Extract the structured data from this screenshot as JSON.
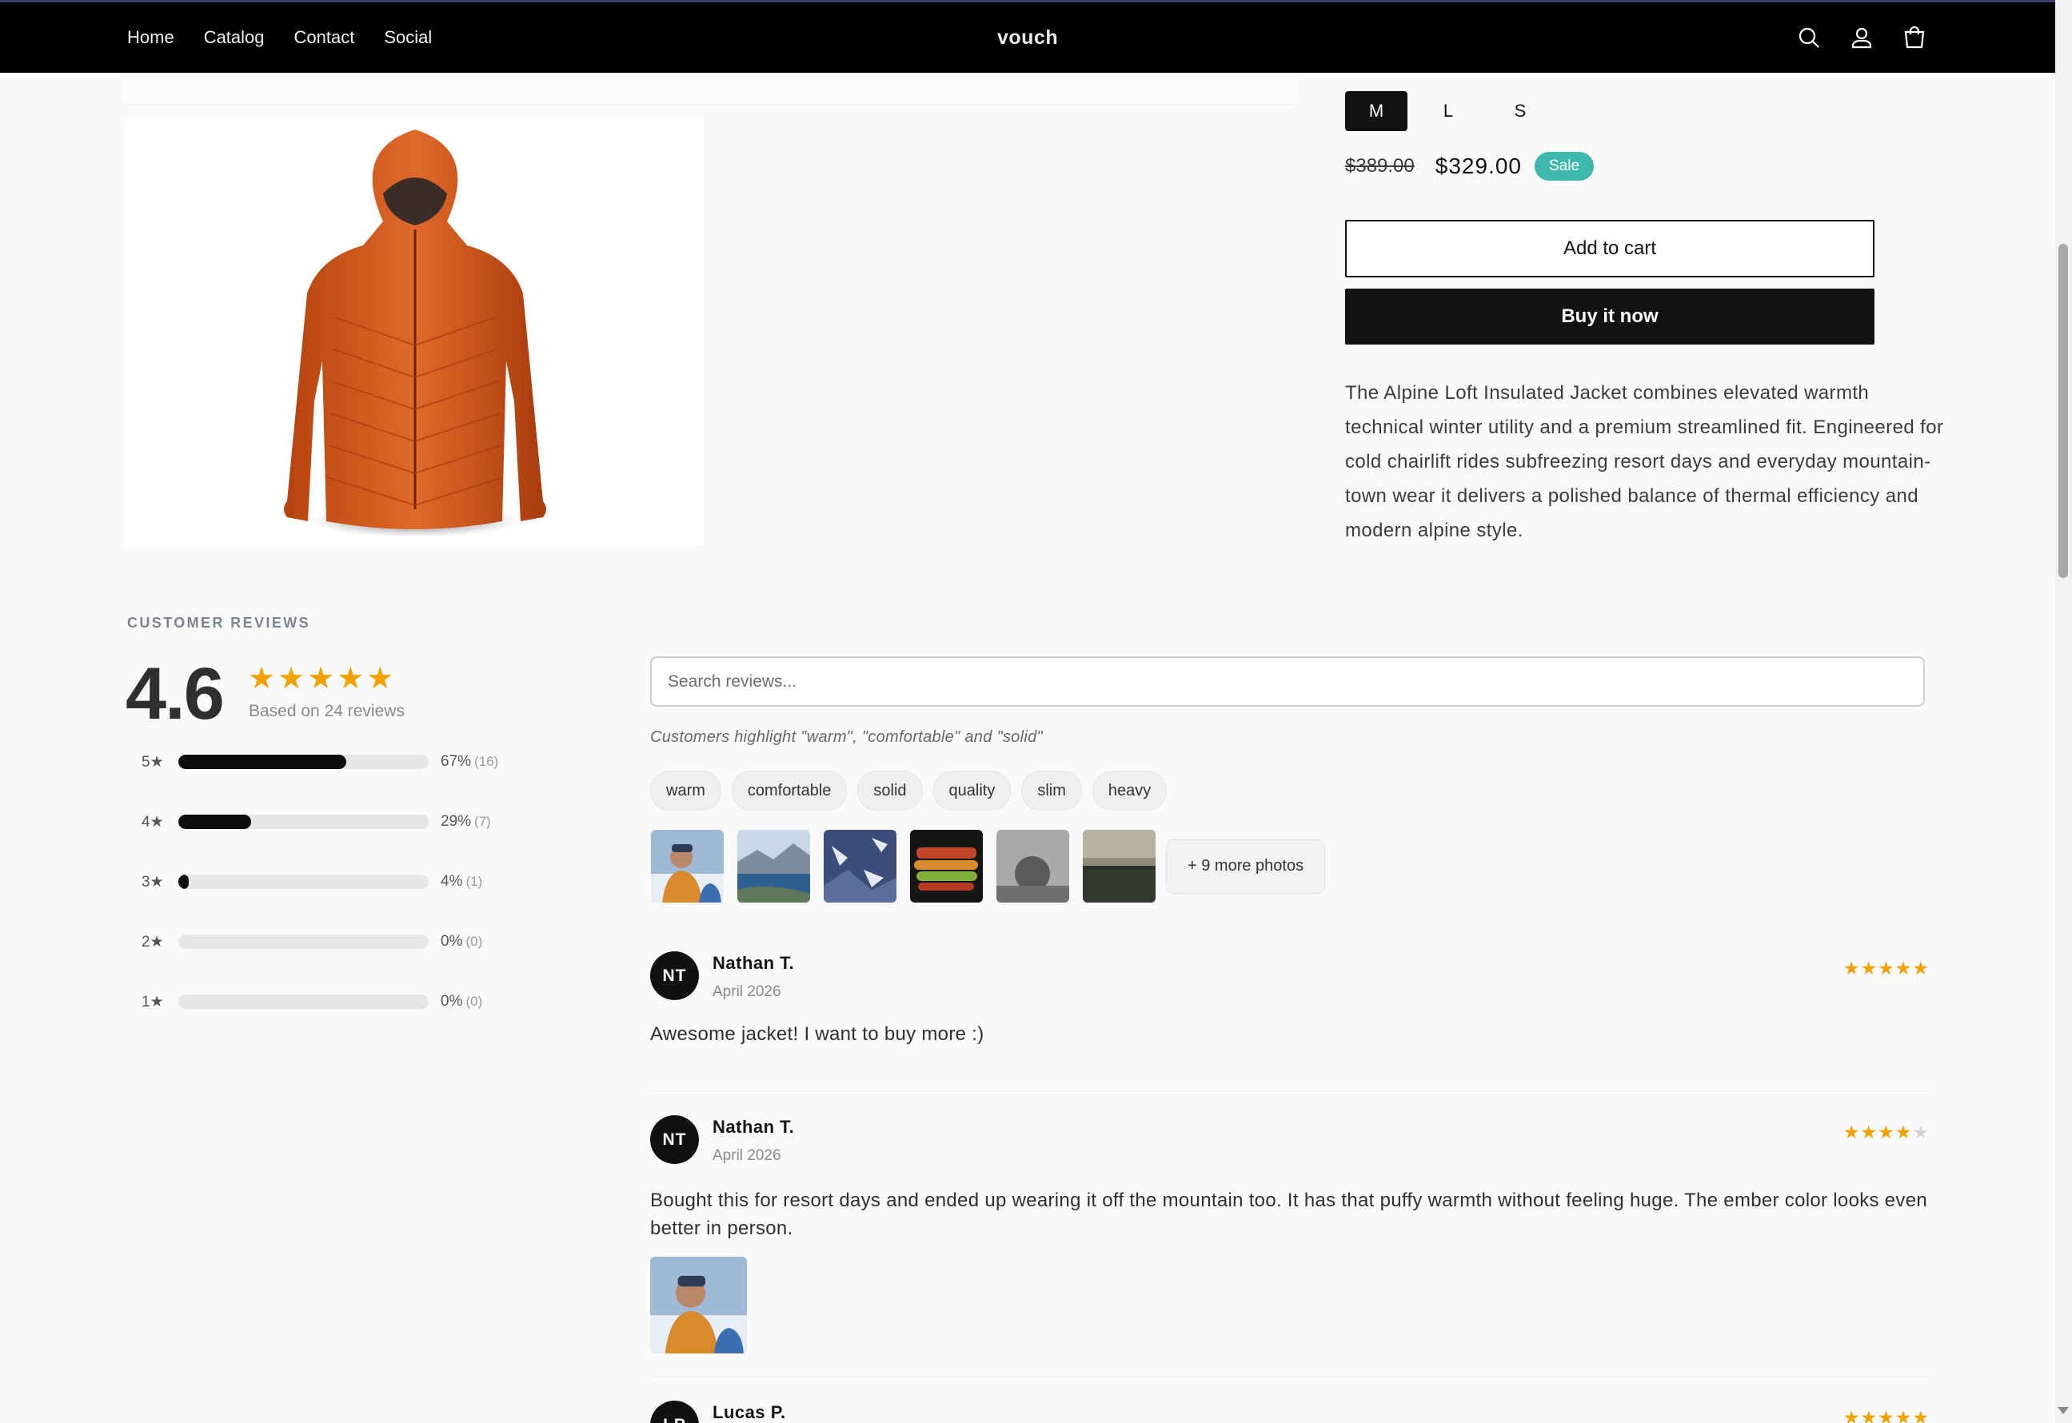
{
  "nav": {
    "items": [
      "Home",
      "Catalog",
      "Contact",
      "Social"
    ],
    "brand": "vouch"
  },
  "header_icons": [
    "search-icon",
    "account-icon",
    "cart-icon"
  ],
  "product": {
    "sizes": [
      "M",
      "L",
      "S"
    ],
    "selected_size": "M",
    "price_old": "$389.00",
    "price_new": "$329.00",
    "sale_badge": "Sale",
    "add_to_cart": "Add to cart",
    "buy_now": "Buy it now",
    "description": "The Alpine Loft Insulated Jacket combines elevated warmth technical winter utility and a premium streamlined fit. Engineered for cold chairlift rides subfreezing resort days and everyday mountain-town wear it delivers a polished balance of thermal efficiency and modern alpine style."
  },
  "reviews_summary": {
    "title": "CUSTOMER REVIEWS",
    "average": "4.6",
    "stars": "★★★★★",
    "based_on": "Based on 24 reviews",
    "histogram": [
      {
        "label": "5★",
        "percent": "67%",
        "count": "(16)",
        "fraction": 0.67
      },
      {
        "label": "4★",
        "percent": "29%",
        "count": "(7)",
        "fraction": 0.29
      },
      {
        "label": "3★",
        "percent": "4%",
        "count": "(1)",
        "fraction": 0.04
      },
      {
        "label": "2★",
        "percent": "0%",
        "count": "(0)",
        "fraction": 0
      },
      {
        "label": "1★",
        "percent": "0%",
        "count": "(0)",
        "fraction": 0
      }
    ]
  },
  "reviews_tools": {
    "search_placeholder": "Search reviews...",
    "highlight": "Customers highlight \"warm\", \"comfortable\" and \"solid\"",
    "tags": [
      "warm",
      "comfortable",
      "solid",
      "quality",
      "slim",
      "heavy"
    ],
    "more_photos": "+ 9 more photos"
  },
  "reviews": [
    {
      "initials": "NT",
      "name": "Nathan T.",
      "date": "April 2026",
      "rating": 5,
      "text": "Awesome jacket! I want to buy more :)"
    },
    {
      "initials": "NT",
      "name": "Nathan T.",
      "date": "April 2026",
      "rating": 4,
      "text": "Bought this for resort days and ended up wearing it off the mountain too. It has that puffy warmth without feeling huge. The ember color looks even better in person."
    },
    {
      "initials": "LP",
      "name": "Lucas P.",
      "date": "",
      "rating": 5,
      "text": ""
    }
  ],
  "colors": {
    "accent_star": "#f2a200",
    "sale_badge": "#3db8ad",
    "header_bg": "#000000"
  }
}
